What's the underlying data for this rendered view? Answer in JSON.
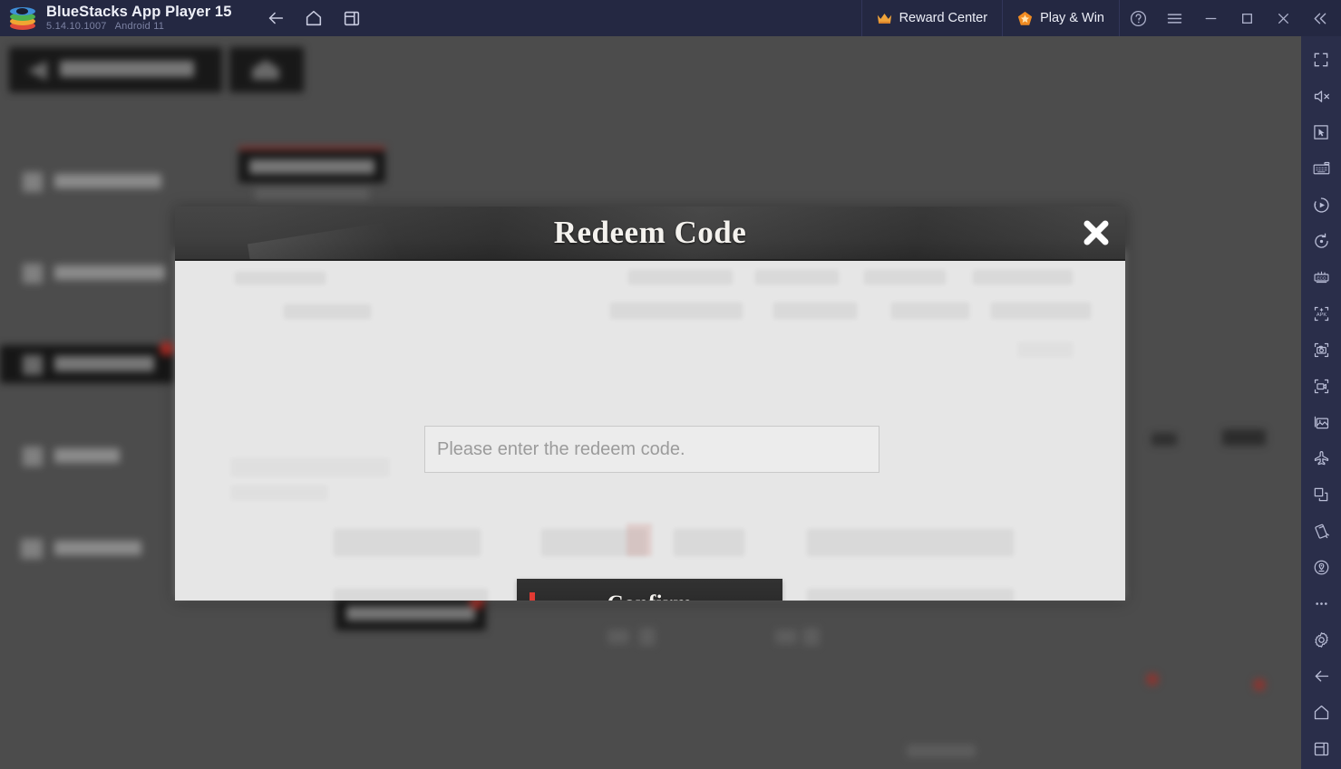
{
  "window": {
    "app_title": "BlueStacks App Player 15",
    "version": "5.14.10.1007",
    "android_version": "Android 11",
    "logo_icon": "bluestacks-logo-icon",
    "nav": [
      {
        "name": "back-button",
        "icon": "arrow-left-icon"
      },
      {
        "name": "home-button",
        "icon": "home-icon"
      },
      {
        "name": "multi-instance-button",
        "icon": "window-stack-icon"
      }
    ],
    "reward_center": {
      "label": "Reward Center",
      "icon": "crown-icon"
    },
    "play_and_win": {
      "label": "Play & Win",
      "icon": "pentagon-star-icon"
    },
    "controls": [
      {
        "name": "help-button",
        "icon": "question-circle-icon"
      },
      {
        "name": "menu-button",
        "icon": "hamburger-icon"
      },
      {
        "name": "minimize-button",
        "icon": "minimize-icon"
      },
      {
        "name": "maximize-button",
        "icon": "maximize-icon"
      },
      {
        "name": "close-button",
        "icon": "close-icon"
      },
      {
        "name": "collapse-button",
        "icon": "chevron-double-left-icon"
      }
    ]
  },
  "sidebar": {
    "background_color": "#2a2e4a",
    "items": [
      {
        "name": "fullscreen-button",
        "icon": "fullscreen-icon"
      },
      {
        "name": "mute-button",
        "icon": "speaker-mute-icon"
      },
      {
        "name": "pointer-mode-button",
        "icon": "cursor-in-box-icon"
      },
      {
        "name": "game-controls-button",
        "icon": "keyboard-icon"
      },
      {
        "name": "macro-recorder-button",
        "icon": "play-circle-icon"
      },
      {
        "name": "rotate-button",
        "icon": "rotate-circle-icon"
      },
      {
        "name": "eco-mode-button",
        "icon": "eco-mode-icon"
      },
      {
        "name": "install-apk-button",
        "icon": "apk-icon"
      },
      {
        "name": "screenshot-button",
        "icon": "camera-icon"
      },
      {
        "name": "record-screen-button",
        "icon": "video-camera-icon"
      },
      {
        "name": "media-manager-button",
        "icon": "image-gallery-icon"
      },
      {
        "name": "airplane-mode-button",
        "icon": "airplane-icon"
      },
      {
        "name": "copy-button",
        "icon": "copy-icon"
      },
      {
        "name": "shake-button",
        "icon": "shake-icon"
      },
      {
        "name": "location-button",
        "icon": "location-pin-icon"
      },
      {
        "name": "more-options-button",
        "icon": "ellipsis-icon"
      },
      {
        "name": "settings-button",
        "icon": "gear-icon"
      },
      {
        "name": "back-button",
        "icon": "arrow-left-icon"
      },
      {
        "name": "home-button",
        "icon": "home-icon"
      },
      {
        "name": "recent-apps-button",
        "icon": "window-stack-icon"
      }
    ]
  },
  "modal": {
    "title": "Redeem Code",
    "close_icon": "close-x-icon",
    "input": {
      "placeholder": "Please enter the redeem code.",
      "value": ""
    },
    "confirm": {
      "label": "Confirm",
      "accent_color": "#e23a33"
    },
    "header_color": "#383838",
    "body_color": "#e6e6e6"
  },
  "background": {
    "blurred": true,
    "description": "Blurred game settings screen behind the modal overlay"
  }
}
